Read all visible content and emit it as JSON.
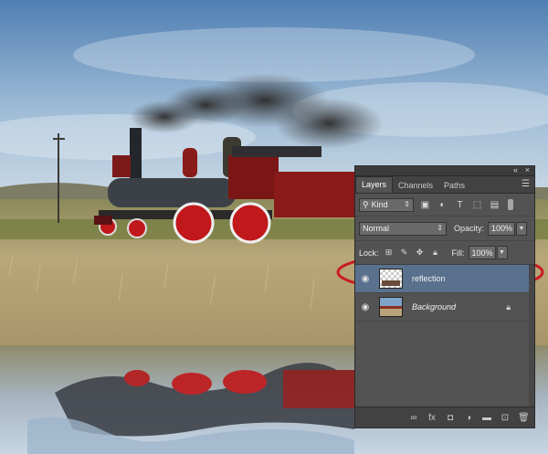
{
  "panel": {
    "tabs": [
      {
        "label": "Layers"
      },
      {
        "label": "Channels"
      },
      {
        "label": "Paths"
      }
    ],
    "filter": {
      "kind_label": "Kind"
    },
    "blend_mode": "Normal",
    "opacity_label": "Opacity:",
    "opacity_value": "100%",
    "lock_label": "Lock:",
    "fill_label": "Fill:",
    "fill_value": "100%",
    "layers": [
      {
        "name": "reflection",
        "selected": true
      },
      {
        "name": "Background",
        "selected": false,
        "locked": true
      }
    ]
  },
  "annotation": {
    "color": "#c81e1e"
  },
  "colors": {
    "panel_bg": "#535353",
    "selection": "#59718d"
  }
}
